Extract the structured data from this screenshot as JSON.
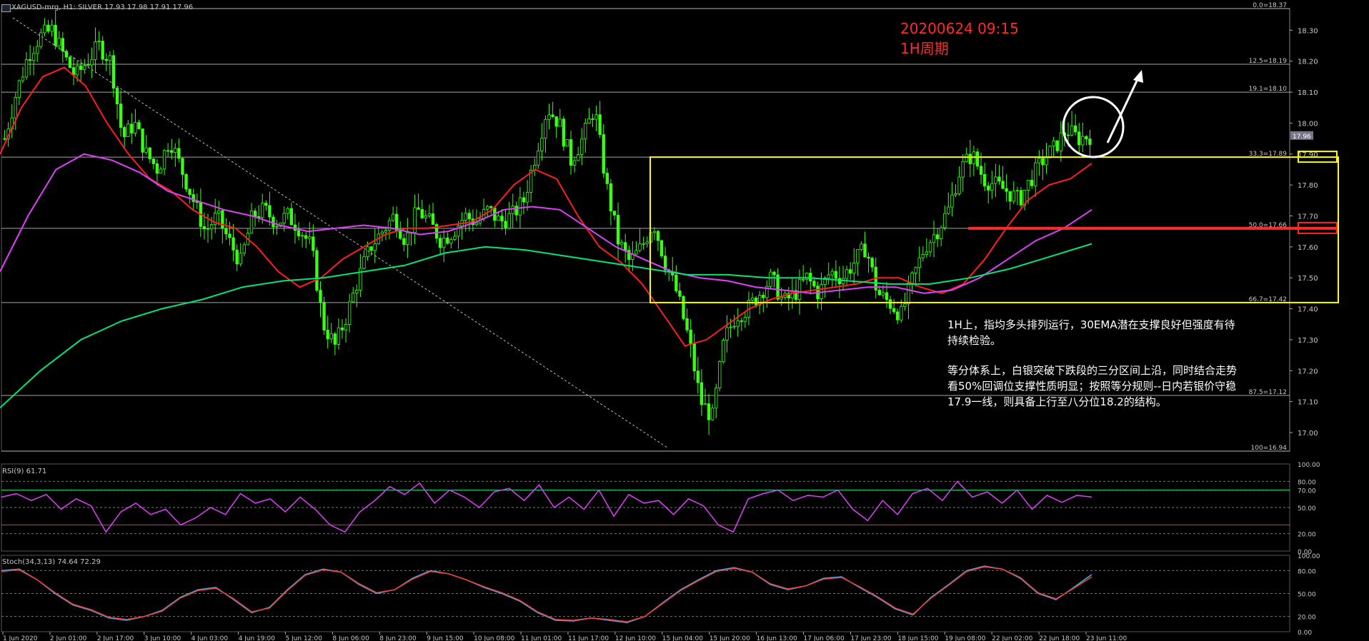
{
  "window": {
    "title": "XAGUSD-mrg, H1:  SILVER  17.93 17.98 17.91 17.96"
  },
  "annotation": {
    "datetime": "20200624 09:15",
    "period": "1H周期",
    "note_p1": "1H上，指均多头排列运行，30EMA潜在支撑良好但强度有待持续检验。",
    "note_p2": "等分体系上，白银突破下跌段的三分区间上沿，同时结合走势看50%回调位支撑性质明显；按照等分规则--日内若银价守稳17.9一线，则具备上行至八分位18.2的结构。"
  },
  "colors": {
    "background": "#000000",
    "candle": "#39ff14",
    "ema_fast": "#ff1e1e",
    "ema_mid": "#e040fb",
    "ema_slow": "#00e676",
    "box": "#ffff00",
    "rsi": "#e040fb",
    "stoch_main": "#29b6f6",
    "stoch_signal": "#ff3b3b",
    "fib_level": "#d0d0d0",
    "annotation_red": "#ff2a2a",
    "annotation_text": "#ffffff"
  },
  "chart_data": [
    {
      "type": "candlestick",
      "title": "XAGUSD-mrg, H1:  SILVER  17.93 17.98 17.91 17.96",
      "symbol": "XAGUSD-mrg",
      "timeframe": "H1",
      "ohlc_last": {
        "open": 17.93,
        "high": 17.98,
        "low": 17.91,
        "close": 17.96
      },
      "current_price_label": "17.96",
      "ylim": [
        16.94,
        18.37
      ],
      "y_ticks": [
        "18.30",
        "18.20",
        "18.10",
        "18.00",
        "17.90",
        "17.80",
        "17.70",
        "17.60",
        "17.50",
        "17.40",
        "17.30",
        "17.20",
        "17.10",
        "17.00"
      ],
      "x_ticks": [
        "1 Jun 2020",
        "2 Jun 01:00",
        "2 Jun 17:00",
        "3 Jun 10:00",
        "4 Jun 03:00",
        "4 Jun 19:00",
        "5 Jun 12:00",
        "8 Jun 06:00",
        "8 Jun 23:00",
        "9 Jun 15:00",
        "10 Jun 08:00",
        "11 Jun 01:00",
        "11 Jun 17:00",
        "12 Jun 10:00",
        "15 Jun 04:00",
        "15 Jun 20:00",
        "16 Jun 13:00",
        "17 Jun 06:00",
        "17 Jun 23:00",
        "18 Jun 15:00",
        "19 Jun 08:00",
        "22 Jun 02:00",
        "22 Jun 18:00",
        "23 Jun 11:00"
      ],
      "close_path": [
        17.95,
        18.1,
        18.22,
        18.28,
        18.3,
        18.22,
        18.15,
        18.2,
        18.25,
        18.2,
        17.95,
        18.0,
        17.9,
        17.85,
        17.95,
        17.85,
        17.75,
        17.65,
        17.7,
        17.62,
        17.55,
        17.7,
        17.72,
        17.68,
        17.7,
        17.66,
        17.6,
        17.35,
        17.28,
        17.38,
        17.5,
        17.6,
        17.65,
        17.7,
        17.62,
        17.72,
        17.68,
        17.62,
        17.65,
        17.7,
        17.68,
        17.72,
        17.68,
        17.7,
        17.75,
        17.9,
        18.05,
        18.0,
        17.88,
        17.95,
        18.05,
        17.8,
        17.62,
        17.55,
        17.6,
        17.68,
        17.55,
        17.45,
        17.3,
        17.1,
        17.05,
        17.3,
        17.38,
        17.4,
        17.45,
        17.5,
        17.42,
        17.45,
        17.5,
        17.45,
        17.52,
        17.5,
        17.55,
        17.6,
        17.45,
        17.42,
        17.38,
        17.5,
        17.6,
        17.65,
        17.72,
        17.85,
        17.9,
        17.82,
        17.8,
        17.78,
        17.75,
        17.82,
        17.88,
        17.92,
        17.98,
        17.95,
        17.96
      ],
      "fib_levels": [
        {
          "label": "0.0=18.37",
          "value": 18.37
        },
        {
          "label": "12.5=18.19",
          "value": 18.19
        },
        {
          "label": "19.1=18.10",
          "value": 18.1
        },
        {
          "label": "33.3=17.89",
          "value": 17.89
        },
        {
          "label": "50.0=17.66",
          "value": 17.66
        },
        {
          "label": "66.7=17.42",
          "value": 17.42
        },
        {
          "label": "87.5=17.12",
          "value": 17.12
        },
        {
          "label": "100=16.94",
          "value": 16.94
        }
      ],
      "series": [
        {
          "name": "",
          "role": "ema_fast",
          "values": [
            17.9,
            18.05,
            18.15,
            18.18,
            18.12,
            18.0,
            17.9,
            17.82,
            17.78,
            17.72,
            17.68,
            17.66,
            17.6,
            17.52,
            17.47,
            17.5,
            17.56,
            17.6,
            17.64,
            17.66,
            17.66,
            17.67,
            17.68,
            17.72,
            17.8,
            17.85,
            17.82,
            17.7,
            17.6,
            17.55,
            17.48,
            17.38,
            17.28,
            17.3,
            17.35,
            17.4,
            17.43,
            17.45,
            17.46,
            17.47,
            17.48,
            17.5,
            17.5,
            17.47,
            17.45,
            17.48,
            17.56,
            17.66,
            17.75,
            17.8,
            17.82,
            17.87
          ]
        },
        {
          "name": "",
          "role": "ema_mid",
          "values": [
            17.52,
            17.7,
            17.85,
            17.9,
            17.88,
            17.84,
            17.78,
            17.75,
            17.72,
            17.7,
            17.67,
            17.65,
            17.66,
            17.67,
            17.66,
            17.64,
            17.65,
            17.68,
            17.72,
            17.73,
            17.72,
            17.66,
            17.6,
            17.56,
            17.52,
            17.5,
            17.49,
            17.47,
            17.46,
            17.45,
            17.46,
            17.47,
            17.47,
            17.45,
            17.46,
            17.5,
            17.56,
            17.62,
            17.66,
            17.72
          ]
        },
        {
          "name": "",
          "role": "ema_slow",
          "values": [
            17.08,
            17.2,
            17.3,
            17.36,
            17.4,
            17.43,
            17.47,
            17.49,
            17.5,
            17.52,
            17.54,
            17.58,
            17.6,
            17.59,
            17.57,
            17.55,
            17.53,
            17.51,
            17.51,
            17.5,
            17.5,
            17.49,
            17.48,
            17.48,
            17.5,
            17.53,
            17.57,
            17.61
          ]
        }
      ],
      "box": {
        "y_top": 17.89,
        "y_bottom": 17.42,
        "x_start": "15 Jun 04:00"
      },
      "support_line": {
        "value": 17.66
      }
    },
    {
      "type": "line",
      "title": "RSI(9) 61.71",
      "ylim": [
        0,
        100
      ],
      "y_ticks": [
        "100.00",
        "80.00",
        "70.00",
        "50.00",
        "20.00",
        "0.00"
      ],
      "levels": [
        70,
        30
      ],
      "series": [
        {
          "name": "RSI(9)",
          "values": [
            62,
            66,
            58,
            65,
            48,
            60,
            52,
            22,
            45,
            55,
            42,
            48,
            30,
            38,
            50,
            42,
            66,
            55,
            60,
            45,
            62,
            48,
            30,
            22,
            45,
            58,
            74,
            65,
            78,
            55,
            70,
            62,
            50,
            68,
            72,
            58,
            76,
            50,
            62,
            48,
            70,
            40,
            65,
            55,
            58,
            42,
            60,
            52,
            30,
            22,
            60,
            66,
            70,
            58,
            64,
            62,
            70,
            48,
            35,
            58,
            42,
            66,
            72,
            58,
            80,
            62,
            68,
            55,
            70,
            48,
            64,
            56,
            64,
            62
          ]
        }
      ]
    },
    {
      "type": "line",
      "title": "Stoch(34,3,13) 74.64 72.29",
      "ylim": [
        0,
        100
      ],
      "y_ticks": [
        "100.00",
        "80.00",
        "50.00",
        "20.00",
        "0.00"
      ],
      "series": [
        {
          "name": "Stoch main",
          "values": [
            80,
            82,
            68,
            50,
            35,
            28,
            18,
            15,
            20,
            28,
            45,
            55,
            58,
            42,
            25,
            32,
            55,
            75,
            82,
            78,
            62,
            50,
            55,
            70,
            80,
            76,
            68,
            58,
            50,
            40,
            25,
            15,
            14,
            18,
            15,
            12,
            20,
            38,
            55,
            68,
            80,
            84,
            78,
            62,
            55,
            60,
            70,
            72,
            58,
            45,
            30,
            22,
            45,
            62,
            80,
            86,
            82,
            70,
            50,
            42,
            58,
            75
          ]
        },
        {
          "name": "Stoch signal",
          "values": [
            79,
            81,
            68,
            51,
            36,
            29,
            19,
            16,
            20,
            27,
            44,
            54,
            57,
            43,
            26,
            31,
            54,
            74,
            81,
            78,
            63,
            51,
            55,
            69,
            79,
            76,
            68,
            59,
            51,
            41,
            26,
            16,
            15,
            18,
            16,
            13,
            20,
            37,
            54,
            67,
            79,
            83,
            78,
            63,
            56,
            60,
            69,
            71,
            59,
            46,
            31,
            23,
            44,
            61,
            79,
            85,
            82,
            71,
            51,
            43,
            57,
            72
          ]
        }
      ]
    }
  ]
}
